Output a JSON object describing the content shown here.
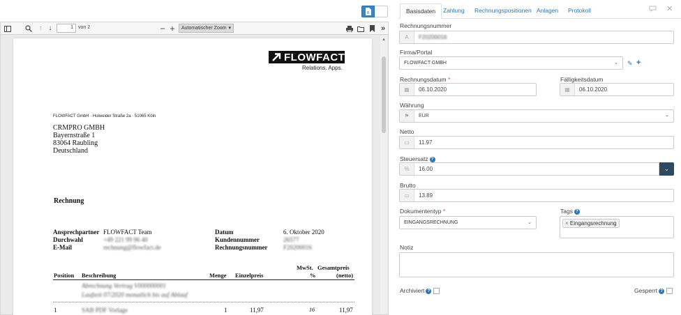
{
  "viewer": {
    "page_current": "1",
    "page_of": "von 2",
    "zoom": "Automatischer Zoom"
  },
  "pdf": {
    "logo_text": "FLOWFACT",
    "slogan": "Relations. Apps.",
    "sender_line": "FLOWFACT GmbH · Holweider Straße 2a · 51065 Köln",
    "recipient": [
      "CRMPRO GMBH",
      "Bayernstraße 1",
      "83064 Raubling",
      "Deutschland"
    ],
    "heading": "Rechnung",
    "contact_labels": [
      "Ansprechpartner",
      "Durchwahl",
      "E-Mail"
    ],
    "contact_values": [
      "FLOWFACT Team",
      "+49 221 99 96 40",
      "rechnung@flowfact.de"
    ],
    "doc_labels": [
      "Datum",
      "Kundennummer",
      "Rechnungsnummer"
    ],
    "doc_values": [
      "6. Oktober 2020",
      "26577",
      "F20200016"
    ],
    "table_headers": {
      "position": "Position",
      "description": "Beschreibung",
      "quantity": "Menge",
      "unit_price": "Einzelpreis",
      "vat": "MwSt.",
      "vat_unit": "%",
      "total": "Gesamtpreis",
      "total_note": "(netto)"
    },
    "intro_lines": [
      "Abrechnung Vertrag V000000001",
      "Laufzeit 07/2020 monatlich bis auf Ablauf"
    ],
    "row1": {
      "position": "1",
      "description": "SAB PDF Vorlage",
      "quantity": "1",
      "unit_price": "11,97",
      "vat": "16",
      "total": "11,97"
    }
  },
  "tabs": [
    "Basisdaten",
    "Zahlung",
    "Rechnungspositionen",
    "Anlagen",
    "Protokoll"
  ],
  "form": {
    "rechnungsnummer_label": "Rechnungsnummer",
    "rechnungsnummer_value": "F20200016",
    "firma_label": "Firma/Portal",
    "firma_value": "FLOWFACT GMBH",
    "rechnungsdatum_label": "Rechnungsdatum",
    "rechnungsdatum_value": "06.10.2020",
    "faelligkeitsdatum_label": "Fälligkeitsdatum",
    "faelligkeitsdatum_value": "06.10.2020",
    "waehrung_label": "Währung",
    "waehrung_value": "EUR",
    "netto_label": "Netto",
    "netto_value": "11.97",
    "steuersatz_label": "Steuersatz",
    "steuersatz_value": "16.00",
    "brutto_label": "Brutto",
    "brutto_value": "13.89",
    "dokumenttyp_label": "Dokumententyp",
    "dokumenttyp_value": "EINGANGSRECHNUNG",
    "tags_label": "Tags",
    "tag_value": "Eingangsrechnung",
    "notiz_label": "Notiz",
    "archiviert_label": "Archiviert",
    "gesperrt_label": "Gesperrt"
  },
  "colors": {
    "accent": "#2a76b8",
    "dark_button": "#2d4a60",
    "required": "#d9534f"
  }
}
